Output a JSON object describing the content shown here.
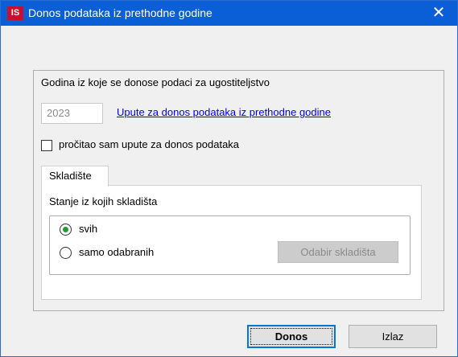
{
  "window": {
    "app_icon_text": "IS",
    "title": "Donos podataka iz prethodne godine",
    "close_glyph": "✕",
    "titlebar_color": "#0a5fd6"
  },
  "form": {
    "heading": "Godina iz koje se donose podaci za ugostiteljstvo",
    "year_value": "2023",
    "link_text": "Upute za donos podataka iz prethodne godine",
    "checkbox_label": "pročitao sam upute za donos podataka",
    "checkbox_checked": false
  },
  "tabs": [
    {
      "label": "Skladište",
      "active": true
    }
  ],
  "panel": {
    "heading": "Stanje iz kojih skladišta",
    "options": [
      {
        "label": "svih",
        "selected": true
      },
      {
        "label": "samo odabranih",
        "selected": false
      }
    ],
    "choose_button": "Odabir skladišta",
    "choose_button_enabled": false
  },
  "buttons": {
    "donos": "Donos",
    "izlaz": "Izlaz"
  }
}
